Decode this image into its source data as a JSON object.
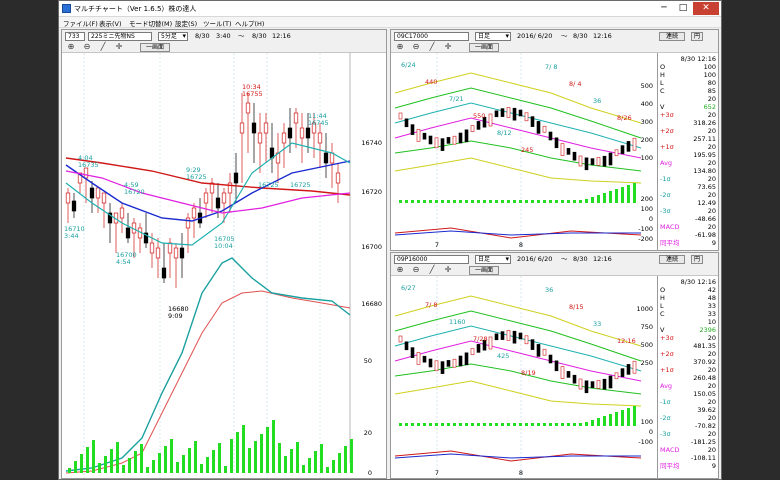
{
  "window": {
    "title": "マルチチャート（Ver 1.6.5）株の達人",
    "minimize": "─",
    "maximize": "□",
    "close": "✕"
  },
  "menu": [
    "ファイル(F)",
    "表示(V)",
    "モード切替(M)",
    "設定(S)",
    "ツール(T)",
    "ヘルプ(H)"
  ],
  "main_chart": {
    "code": "733",
    "name": "225ミニ先物NS",
    "interval": "5分足",
    "range_from": "8/30",
    "range_from_time": "3:40",
    "tilde": "～",
    "range_to": "8/30",
    "range_to_time": "12:16",
    "one_screen": "一画面",
    "price_ticks": [
      "16740",
      "16720",
      "16700",
      "16680"
    ],
    "osc_ticks": [
      "50",
      "20",
      "0"
    ],
    "time_ticks": [
      "4:00",
      "30",
      "10:00",
      "11:00",
      "12:00"
    ],
    "annotations": [
      {
        "text": "10:34"
      },
      {
        "text": "16755"
      },
      {
        "text": "11:44"
      },
      {
        "text": "16745"
      },
      {
        "text": "4:04"
      },
      {
        "text": "16735"
      },
      {
        "text": "9:29"
      },
      {
        "text": "16725"
      },
      {
        "text": "4:59"
      },
      {
        "text": "16720"
      },
      {
        "text": "16725"
      },
      {
        "text": "16725"
      },
      {
        "text": "16710"
      },
      {
        "text": "3:44"
      },
      {
        "text": "16705"
      },
      {
        "text": "10:04"
      },
      {
        "text": "16700"
      },
      {
        "text": "4:54"
      },
      {
        "text": "16680"
      },
      {
        "text": "9:09"
      }
    ],
    "colors": {
      "ma_short": "#20b0b0",
      "ma_mid": "#1a2ad0",
      "ma_long": "#d01818",
      "ma_extra": "#e020e0",
      "up": "#d01818",
      "down": "#000000",
      "volume": "#22dd22",
      "osc_a": "#1aa0a0",
      "osc_b": "#e05050"
    }
  },
  "top_chart": {
    "code": "09C17000",
    "interval": "日足",
    "from": "2016/ 6/20",
    "tilde": "～",
    "to": "8/30",
    "to_time": "12:16",
    "link": "連続",
    "yen": "円",
    "price_ticks": [
      "500",
      "400",
      "300",
      "200",
      "100"
    ],
    "vol_ticks": [
      "200",
      "100",
      "0",
      "-100",
      "-200"
    ],
    "date_ticks": [
      "7",
      "8"
    ],
    "annotations": [
      {
        "text": "6/24"
      },
      {
        "text": "440"
      },
      {
        "text": "7/21"
      },
      {
        "text": "550"
      },
      {
        "text": "8/12"
      },
      {
        "text": "245"
      },
      {
        "text": "7/ 8"
      },
      {
        "text": "8/ 4"
      },
      {
        "text": "36"
      },
      {
        "text": "8/26"
      }
    ],
    "side": [
      {
        "k": "",
        "v": "8/30 12:16"
      },
      {
        "k": "O",
        "v": "100"
      },
      {
        "k": "H",
        "v": "100"
      },
      {
        "k": "L",
        "v": "80"
      },
      {
        "k": "C",
        "v": "85"
      },
      {
        "k": "",
        "v": "20"
      },
      {
        "k": "V",
        "v": "652"
      },
      {
        "k": "+3σ",
        "v": "20"
      },
      {
        "k": "",
        "v": "318.26"
      },
      {
        "k": "+2σ",
        "v": "20"
      },
      {
        "k": "",
        "v": "257.11"
      },
      {
        "k": "+1σ",
        "v": "20"
      },
      {
        "k": "",
        "v": "195.95"
      },
      {
        "k": "Avg",
        "v": "20"
      },
      {
        "k": "",
        "v": "134.80"
      },
      {
        "k": "-1σ",
        "v": "20"
      },
      {
        "k": "",
        "v": "73.65"
      },
      {
        "k": "-2σ",
        "v": "20"
      },
      {
        "k": "",
        "v": "12.49"
      },
      {
        "k": "-3σ",
        "v": "20"
      },
      {
        "k": "",
        "v": "-48.66"
      },
      {
        "k": "MACD",
        "v": "20"
      },
      {
        "k": "",
        "v": "-61.98"
      },
      {
        "k": "同平均",
        "v": "9"
      }
    ]
  },
  "bottom_chart": {
    "code": "09P16000",
    "interval": "日足",
    "from": "2016/ 6/20",
    "tilde": "～",
    "to": "8/30",
    "to_time": "12:16",
    "link": "連続",
    "yen": "円",
    "price_ticks": [
      "1000",
      "750",
      "500",
      "250"
    ],
    "vol_ticks": [
      "100",
      "0",
      "-100"
    ],
    "date_ticks": [
      "7",
      "8"
    ],
    "annotations": [
      {
        "text": "6/27"
      },
      {
        "text": "7/ 8"
      },
      {
        "text": "1160"
      },
      {
        "text": "7/28"
      },
      {
        "text": "425"
      },
      {
        "text": "8/19"
      },
      {
        "text": "36"
      },
      {
        "text": "8/15"
      },
      {
        "text": "33"
      },
      {
        "text": "12:16"
      }
    ],
    "side": [
      {
        "k": "",
        "v": "8/30 12:16"
      },
      {
        "k": "O",
        "v": "42"
      },
      {
        "k": "H",
        "v": "48"
      },
      {
        "k": "L",
        "v": "33"
      },
      {
        "k": "C",
        "v": "33"
      },
      {
        "k": "",
        "v": "10"
      },
      {
        "k": "V",
        "v": "2396"
      },
      {
        "k": "+3σ",
        "v": "20"
      },
      {
        "k": "",
        "v": "481.35"
      },
      {
        "k": "+2σ",
        "v": "20"
      },
      {
        "k": "",
        "v": "370.92"
      },
      {
        "k": "+1σ",
        "v": "20"
      },
      {
        "k": "",
        "v": "260.48"
      },
      {
        "k": "Avg",
        "v": "20"
      },
      {
        "k": "",
        "v": "150.05"
      },
      {
        "k": "-1σ",
        "v": "20"
      },
      {
        "k": "",
        "v": "39.62"
      },
      {
        "k": "-2σ",
        "v": "20"
      },
      {
        "k": "",
        "v": "-70.82"
      },
      {
        "k": "-3σ",
        "v": "20"
      },
      {
        "k": "",
        "v": "-181.25"
      },
      {
        "k": "MACD",
        "v": "20"
      },
      {
        "k": "",
        "v": "-108.11"
      },
      {
        "k": "同平均",
        "v": "9"
      }
    ]
  },
  "icons": {
    "zoom_in": "magnifier-plus-icon",
    "zoom_out": "magnifier-minus-icon",
    "draw": "pen-icon",
    "crosshair": "crosshair-icon"
  }
}
